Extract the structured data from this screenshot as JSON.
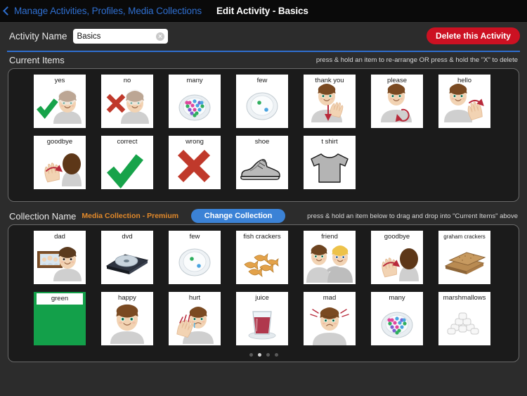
{
  "navbar": {
    "back_label": "Manage Activities, Profiles, Media Collections",
    "back_icon": "chevron-left-icon",
    "title": "Edit Activity - Basics"
  },
  "activity": {
    "label": "Activity Name",
    "name_value": "Basics",
    "name_placeholder": "Activity Name",
    "clear_icon": "clear-circle-icon",
    "delete_label": "Delete this Activity",
    "delete_color": "#cc1122"
  },
  "current_items_section": {
    "title": "Current Items",
    "hint": "press & hold an item to re-arrange OR press & hold the \"X\" to delete",
    "items": [
      {
        "label": "yes",
        "art": "check-with-boy"
      },
      {
        "label": "no",
        "art": "cross-with-boy"
      },
      {
        "label": "many",
        "art": "plate-many-dots"
      },
      {
        "label": "few",
        "art": "plate-few-dots"
      },
      {
        "label": "thank you",
        "art": "boy-thank-you"
      },
      {
        "label": "please",
        "art": "boy-please"
      },
      {
        "label": "hello",
        "art": "boy-hello-wave"
      },
      {
        "label": "goodbye",
        "art": "boy-goodbye-wave-back"
      },
      {
        "label": "correct",
        "art": "green-check"
      },
      {
        "label": "wrong",
        "art": "red-cross"
      },
      {
        "label": "shoe",
        "art": "sneaker"
      },
      {
        "label": "t shirt",
        "art": "tshirt"
      }
    ]
  },
  "collection_section": {
    "title": "Collection Name",
    "collection_name": "Media Collection - Premium",
    "collection_name_color": "#e2892a",
    "change_button_label": "Change Collection",
    "change_button_color": "#3b82d6",
    "hint": "press & hold an item below to drag and drop into \"Current Items\" above",
    "items": [
      {
        "label": "dad",
        "art": "man-with-photo"
      },
      {
        "label": "dvd",
        "art": "dvd-disc-case"
      },
      {
        "label": "few",
        "art": "plate-few-dots"
      },
      {
        "label": "fish crackers",
        "art": "fish-crackers"
      },
      {
        "label": "friend",
        "art": "two-boys"
      },
      {
        "label": "goodbye",
        "art": "boy-goodbye-wave-back"
      },
      {
        "label": "graham crackers",
        "art": "graham-crackers",
        "small_label": true
      },
      {
        "label": "green",
        "art": "color-swatch",
        "swatch_color": "#13a04a"
      },
      {
        "label": "happy",
        "art": "boy-happy"
      },
      {
        "label": "hurt",
        "art": "boy-hurt"
      },
      {
        "label": "juice",
        "art": "juice-glass"
      },
      {
        "label": "mad",
        "art": "boy-mad"
      },
      {
        "label": "many",
        "art": "plate-many-dots"
      },
      {
        "label": "marshmallows",
        "art": "marshmallows"
      }
    ],
    "page_dots": {
      "count": 4,
      "active_index": 1
    }
  }
}
